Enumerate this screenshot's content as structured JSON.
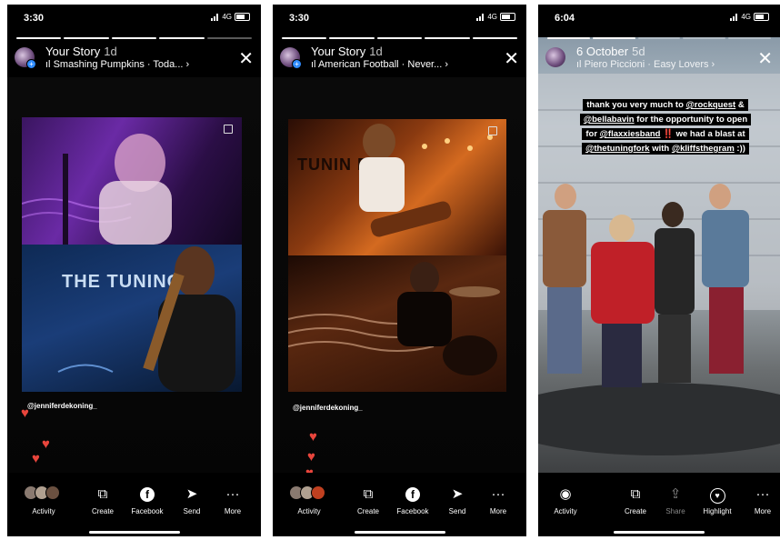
{
  "phone1": {
    "time": "3:30",
    "network": "4G",
    "story_title": "Your Story",
    "story_age": "1d",
    "music": "Smashing Pumpkins · Toda... ›",
    "close_label": "✕",
    "photo_top_text": "",
    "venue_text": "THE TUNING",
    "mention": "@jenniferdekoning_",
    "bottom": [
      {
        "label": "Activity"
      },
      {
        "label": "Create"
      },
      {
        "label": "Facebook"
      },
      {
        "label": "Send"
      },
      {
        "label": "More"
      }
    ]
  },
  "phone2": {
    "time": "3:30",
    "network": "4G",
    "story_title": "Your Story",
    "story_age": "1d",
    "music": "American Football · Never... ›",
    "close_label": "✕",
    "venue_text": "TUNIN FO",
    "mention": "@jenniferdekoning_",
    "bottom": [
      {
        "label": "Activity"
      },
      {
        "label": "Create"
      },
      {
        "label": "Facebook"
      },
      {
        "label": "Send"
      },
      {
        "label": "More"
      }
    ]
  },
  "phone3": {
    "time": "6:04",
    "network": "4G",
    "story_title": "6 October",
    "story_age": "5d",
    "music": "Piero Piccioni · Easy Lovers ›",
    "close_label": "✕",
    "caption": {
      "l1a": "thank you very much to ",
      "l1b": "@rockquest",
      "l1c": " &",
      "l2a": "@bellabavin",
      "l2b": " for the opportunity to open",
      "l3a": "for ",
      "l3b": "@flaxxiesband",
      "l3c": " ‼️",
      "l3d": " we had a blast at",
      "l4a": "@thetuningfork",
      "l4b": " with ",
      "l4c": "@kliffsthegram",
      "l4d": " :))"
    },
    "bottom": [
      {
        "label": "Activity"
      },
      {
        "label": "Create"
      },
      {
        "label": "Share"
      },
      {
        "label": "Highlight"
      },
      {
        "label": "More"
      }
    ]
  },
  "colors": {
    "heart": "#e8453c",
    "accent_blue": "#2f8cff"
  }
}
